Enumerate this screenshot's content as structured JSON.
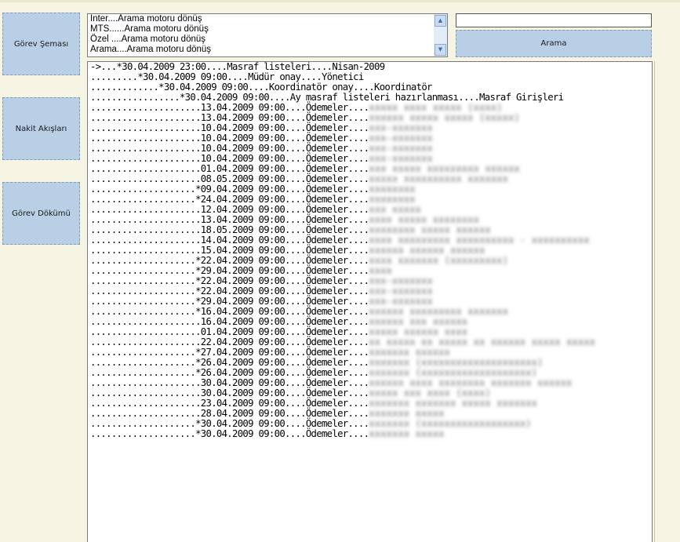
{
  "nav": {
    "gorev_semasi": "Görev Şeması",
    "nakit_akislari": "Nakit Akışları",
    "gorev_dokumu": "Görev Dökümü"
  },
  "listbox": {
    "items": [
      "İnter....Arama motoru dönüş",
      "MTS......Arama motoru dönüş",
      "Özel ....Arama motoru dönüş",
      "Arama....Arama motoru dönüş"
    ],
    "scroll_up_icon": "triangle-up-icon",
    "scroll_down_icon": "triangle-down-icon"
  },
  "search": {
    "value": "",
    "button_label": "Arama"
  },
  "tree": {
    "rows": [
      {
        "dots": "->...",
        "text": "*30.04.2009 23:00....Masraf listeleri....Nisan-2009",
        "blur": ""
      },
      {
        "dots": ".........",
        "text": "*30.04.2009 09:00....Müdür onay....Yönetici",
        "blur": ""
      },
      {
        "dots": ".............",
        "text": "*30.04.2009 09:00....Koordinatör onay....Koordinatör",
        "blur": ""
      },
      {
        "dots": ".................",
        "text": "*30.04.2009 09:00....Ay masraf listeleri hazırlanması....Masraf Girişleri",
        "blur": ""
      },
      {
        "dots": ".....................",
        "text": "13.04.2009 09:00....Ödemeler....",
        "blur": "xxxxx xxxx xxxxx (xxxx)"
      },
      {
        "dots": ".....................",
        "text": "13.04.2009 09:00....Ödemeler....",
        "blur": "xxxxxx xxxxx xxxxx (xxxxx)"
      },
      {
        "dots": ".....................",
        "text": "10.04.2009 09:00....Ödemeler....",
        "blur": "xxx-xxxxxxx"
      },
      {
        "dots": ".....................",
        "text": "10.04.2009 09:00....Ödemeler....",
        "blur": "xxx-xxxxxxx"
      },
      {
        "dots": ".....................",
        "text": "10.04.2009 09:00....Ödemeler....",
        "blur": "xxx-xxxxxxx"
      },
      {
        "dots": ".....................",
        "text": "10.04.2009 09:00....Ödemeler....",
        "blur": "xxx-xxxxxxx"
      },
      {
        "dots": ".....................",
        "text": "01.04.2009 09:00....Ödemeler....",
        "blur": "xxx xxxxx xxxxxxxxx xxxxxx"
      },
      {
        "dots": ".....................",
        "text": "08.05.2009 09:00....Ödemeler....",
        "blur": "xxxxx xxxxxxxxxx xxxxxxx"
      },
      {
        "dots": "....................",
        "text": "*09.04.2009 09:00....Ödemeler....",
        "blur": "xxxxxxxx"
      },
      {
        "dots": "....................",
        "text": "*24.04.2009 09:00....Ödemeler....",
        "blur": "xxxxxxxx"
      },
      {
        "dots": ".....................",
        "text": "12.04.2009 09:00....Ödemeler....",
        "blur": "xxx xxxxx"
      },
      {
        "dots": ".....................",
        "text": "13.04.2009 09:00....Ödemeler....",
        "blur": "xxxx xxxxx xxxxxxxx"
      },
      {
        "dots": ".....................",
        "text": "18.05.2009 09:00....Ödemeler....",
        "blur": "xxxxxxxx xxxxx xxxxxx"
      },
      {
        "dots": ".....................",
        "text": "14.04.2009 09:00....Ödemeler....",
        "blur": "xxxx xxxxxxxxx xxxxxxxxxx - xxxxxxxxxx"
      },
      {
        "dots": ".....................",
        "text": "15.04.2009 09:00....Ödemeler....",
        "blur": "xxxxxx xxxxxx xxxxxx"
      },
      {
        "dots": "....................",
        "text": "*22.04.2009 09:00....Ödemeler....",
        "blur": "xxxx xxxxxxx (xxxxxxxxx)"
      },
      {
        "dots": "....................",
        "text": "*29.04.2009 09:00....Ödemeler....",
        "blur": "xxxx"
      },
      {
        "dots": "....................",
        "text": "*22.04.2009 09:00....Ödemeler....",
        "blur": "xxx-xxxxxxx"
      },
      {
        "dots": "....................",
        "text": "*22.04.2009 09:00....Ödemeler....",
        "blur": "xxx-xxxxxxx"
      },
      {
        "dots": "....................",
        "text": "*29.04.2009 09:00....Ödemeler....",
        "blur": "xxx-xxxxxxx"
      },
      {
        "dots": "....................",
        "text": "*16.04.2009 09:00....Ödemeler....",
        "blur": "xxxxxx xxxxxxxxx xxxxxxx"
      },
      {
        "dots": ".....................",
        "text": "16.04.2009 09:00....Ödemeler....",
        "blur": "xxxxxx xxx xxxxxx"
      },
      {
        "dots": ".....................",
        "text": "01.04.2009 09:00....Ödemeler....",
        "blur": "xxxxx xxxxxx xxxx"
      },
      {
        "dots": ".....................",
        "text": "22.04.2009 09:00....Ödemeler....",
        "blur": "xx xxxxx xx xxxxx xx xxxxxx xxxxx xxxxx"
      },
      {
        "dots": "....................",
        "text": "*27.04.2009 09:00....Ödemeler....",
        "blur": "xxxxxxx xxxxxx"
      },
      {
        "dots": "....................",
        "text": "*26.04.2009 09:00....Ödemeler....",
        "blur": "xxxxxxx (xxxxxxxxxxxxxxxxxxxx)"
      },
      {
        "dots": "....................",
        "text": "*26.04.2009 09:00....Ödemeler....",
        "blur": "xxxxxxx (xxxxxxxxxxxxxxxxxxx)"
      },
      {
        "dots": ".....................",
        "text": "30.04.2009 09:00....Ödemeler....",
        "blur": "xxxxxx xxxx xxxxxxxx xxxxxxx xxxxxx"
      },
      {
        "dots": ".....................",
        "text": "30.04.2009 09:00....Ödemeler....",
        "blur": "xxxxx xxx xxxx (xxxx)"
      },
      {
        "dots": ".....................",
        "text": "23.04.2009 09:00....Ödemeler....",
        "blur": "xxxxxxx xxxxxxx xxxxx xxxxxxx"
      },
      {
        "dots": ".....................",
        "text": "28.04.2009 09:00....Ödemeler....",
        "blur": "xxxxxxx xxxxx"
      },
      {
        "dots": "....................",
        "text": "*30.04.2009 09:00....Ödemeler....",
        "blur": "xxxxxxx (xxxxxxxxxxxxxxxxxx)"
      },
      {
        "dots": "....................",
        "text": "*30.04.2009 09:00....Ödemeler....",
        "blur": "xxxxxxx xxxxx"
      }
    ]
  }
}
